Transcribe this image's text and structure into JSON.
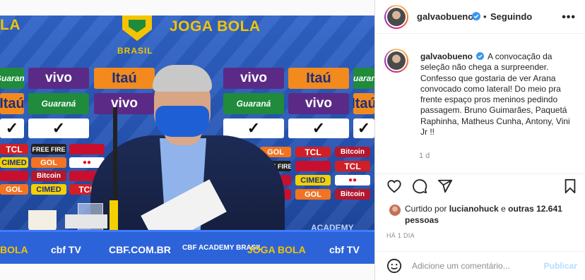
{
  "post": {
    "photo_signage": {
      "top_words": [
        "LA",
        "JOGA BOLA"
      ],
      "crest_text": "BRASIL",
      "sponsors": {
        "vivo": "vivo",
        "itau": "Itaú",
        "guarana": "Guaraná",
        "tcl": "TCL",
        "cimed": "CIMED",
        "gol": "GOL",
        "freefire": "FREE FIRE",
        "bitcoin": "Bitcoin",
        "cbf_academy": "ACADEMY"
      },
      "table_words": [
        "BOLA",
        "cbf TV",
        "CBF.COM.BR",
        "CBF ACADEMY BRASIL",
        "JOGA BOLA",
        "cbf TV"
      ]
    }
  },
  "header": {
    "username": "galvaobueno",
    "separator": "•",
    "follow_state": "Seguindo",
    "more_icon": "more-horizontal-icon"
  },
  "caption": {
    "username": "galvaobueno",
    "text": "A convocação da seleção não chega a surpreender. Confesso que gostaria de ver Arana convocado como lateral! Do meio pra frente espaço pros meninos pedindo passagem. Bruno Guimarães, Paquetá Raphinha, Matheus Cunha, Antony, Vini Jr !!",
    "age": "1 d"
  },
  "actions": {
    "like_icon": "heart-icon",
    "comment_icon": "comment-bubble-icon",
    "share_icon": "paper-plane-icon",
    "save_icon": "bookmark-icon"
  },
  "likes": {
    "prefix": "Curtido por",
    "user": "lucianohuck",
    "connector": "e",
    "others": "outras 12.641 pessoas"
  },
  "timestamp": "HÁ 1 DIA",
  "comment": {
    "placeholder": "Adicione um comentário...",
    "publish_label": "Publicar",
    "emoji_icon": "smiley-icon"
  },
  "colors": {
    "verified": "#3897f0",
    "publish_disabled": "#b2dffc",
    "muted_text": "#8e8e8e"
  }
}
